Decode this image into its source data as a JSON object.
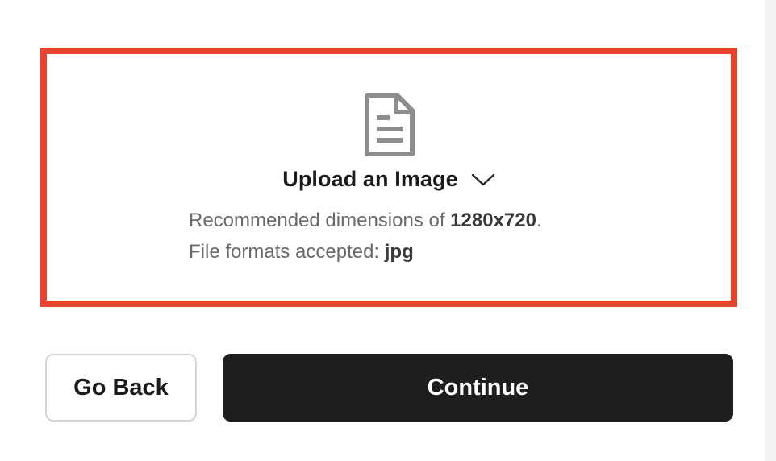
{
  "upload": {
    "icon": "document-icon",
    "title": "Upload an Image",
    "dropdown_icon": "chevron-down-icon",
    "recommended_prefix": "Recommended dimensions of ",
    "recommended_value": "1280x720",
    "recommended_suffix": ".",
    "formats_prefix": "File formats accepted: ",
    "formats_value": "jpg",
    "highlight_color": "#e8432d"
  },
  "actions": {
    "back_label": "Go Back",
    "continue_label": "Continue",
    "continue_color": "#1e1e20"
  }
}
